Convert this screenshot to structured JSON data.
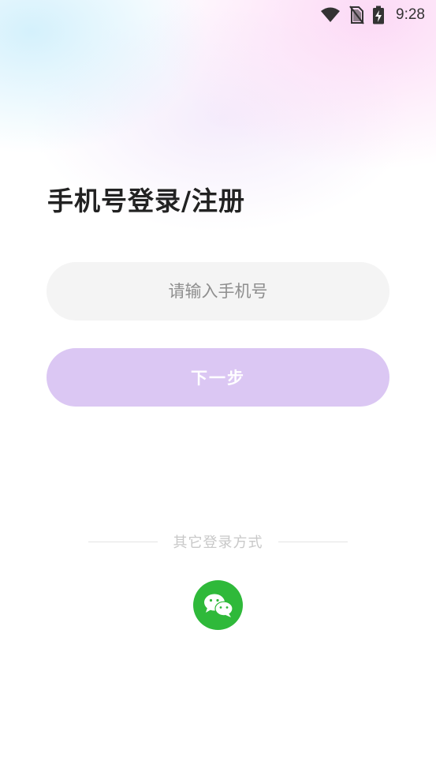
{
  "status_bar": {
    "time": "9:28",
    "icons": [
      "wifi-icon",
      "no-sim-icon",
      "battery-charging-icon"
    ]
  },
  "login": {
    "title": "手机号登录/注册",
    "phone_placeholder": "请输入手机号",
    "phone_value": "",
    "next_label": "下一步"
  },
  "other_login": {
    "label": "其它登录方式",
    "options": [
      "wechat-icon"
    ]
  },
  "colors": {
    "next_button": "#dbc7f3",
    "input_background": "#f4f4f4",
    "wechat_green": "#2fb93a",
    "title_text": "#222222"
  }
}
